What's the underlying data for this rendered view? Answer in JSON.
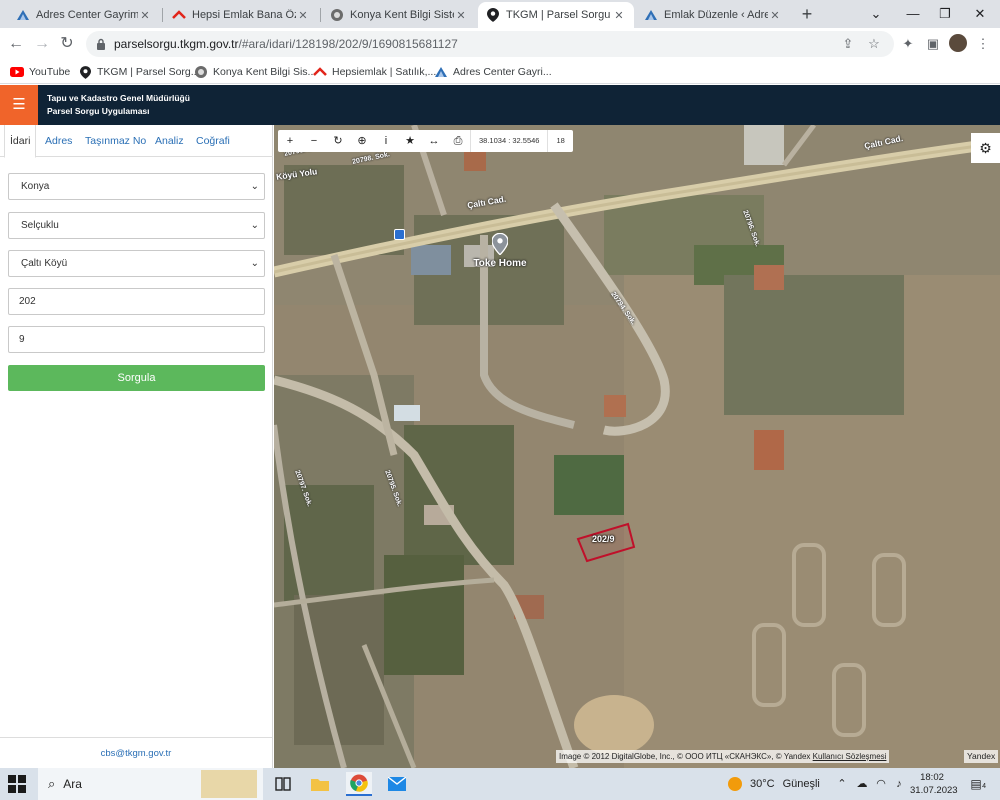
{
  "browser": {
    "tabs": [
      {
        "title": "Adres Center Gayrimenkul",
        "icon": "adres-center-icon",
        "active": false
      },
      {
        "title": "Hepsi Emlak Bana Özel",
        "icon": "hepsiemlak-icon",
        "active": false
      },
      {
        "title": "Konya Kent Bilgi Sistemi",
        "icon": "konya-kent-icon",
        "active": false
      },
      {
        "title": "TKGM | Parsel Sorgu Uygul",
        "icon": "location-pin-icon",
        "active": true
      },
      {
        "title": "Emlak Düzenle ‹ Adres Ce",
        "icon": "adres-center-icon",
        "active": false
      }
    ],
    "url_host": "parselsorgu.tkgm.gov.tr",
    "url_path": "/#ara/idari/128198/202/9/1690815681127",
    "bookmarks": [
      {
        "label": "YouTube",
        "icon": "youtube-icon"
      },
      {
        "label": "TKGM | Parsel Sorg...",
        "icon": "location-pin-icon"
      },
      {
        "label": "Konya Kent Bilgi Sis...",
        "icon": "konya-kent-icon"
      },
      {
        "label": "Hepsiemlak | Satılık,...",
        "icon": "hepsiemlak-icon"
      },
      {
        "label": "Adres Center Gayri...",
        "icon": "adres-center-icon"
      }
    ]
  },
  "app": {
    "title_line1": "Tapu ve Kadastro Genel Müdürlüğü",
    "title_line2": "Parsel Sorgu Uygulaması",
    "accent_color": "#f0642a",
    "header_color": "#0f2336"
  },
  "sidebar": {
    "tabs": [
      "İdari",
      "Adres",
      "Taşınmaz No",
      "Analiz",
      "Coğrafi"
    ],
    "active_tab": "İdari",
    "il": "Konya",
    "ilce": "Selçuklu",
    "mahalle": "Çaltı Köyü",
    "ada": "202",
    "parsel": "9",
    "submit_label": "Sorgula",
    "submit_color": "#5cb85c",
    "footer_email": "cbs@tkgm.gov.tr"
  },
  "map": {
    "coords": "38.1034 : 32.5546",
    "zoom": "18",
    "tools": [
      "zoom-in-icon",
      "zoom-out-icon",
      "refresh-icon",
      "locate-icon",
      "info-icon",
      "star-icon",
      "measure-icon",
      "print-icon"
    ],
    "road_labels": {
      "calti_cad_1": "Çaltı Cad.",
      "calti_cad_2": "Çaltı Cad.",
      "koyu_yolu": "Köyü Yolu",
      "sok_1": "20798. Sok.",
      "sok_2": "20796. Sok.",
      "sok_3": "20794. Sok.",
      "sok_4": "20795. Sok.",
      "sok_5": "20797. Sok.",
      "sok_6": "20793. Sok."
    },
    "poi": "Toke Home",
    "parcel_label": "202/9",
    "parcel_color": "#c0102a",
    "attribution": "Image © 2012 DigitalGlobe, Inc., © ООО ИТЦ «СКАНЭКС», © Yandex",
    "attribution_link": "Kullanıcı Sözleşmesi",
    "provider": "Yandex"
  },
  "taskbar": {
    "search_placeholder": "Ara",
    "weather_temp": "30°C",
    "weather_text": "Güneşli",
    "time": "18:02",
    "date": "31.07.2023",
    "notifications": "4"
  }
}
